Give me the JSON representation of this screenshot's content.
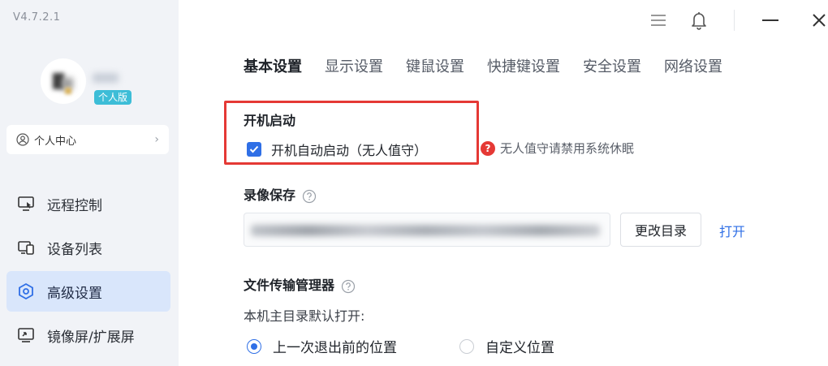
{
  "app": {
    "version": "V4.7.2.1",
    "edition_badge": "个人版"
  },
  "sidebar": {
    "profile_button": {
      "label": "个人中心",
      "icon": "user-circle-icon",
      "chevron": "›"
    },
    "items": [
      {
        "label": "远程控制",
        "icon": "remote-control-icon",
        "active": false
      },
      {
        "label": "设备列表",
        "icon": "device-list-icon",
        "active": false
      },
      {
        "label": "高级设置",
        "icon": "hexagon-settings-icon",
        "active": true
      },
      {
        "label": "镜像屏/扩展屏",
        "icon": "screen-mirror-icon",
        "active": false
      }
    ]
  },
  "titlebar": {
    "icons": [
      "menu-icon",
      "bell-icon",
      "minimize-icon",
      "close-icon"
    ]
  },
  "tabs": [
    {
      "label": "基本设置",
      "active": true
    },
    {
      "label": "显示设置",
      "active": false
    },
    {
      "label": "键鼠设置",
      "active": false
    },
    {
      "label": "快捷键设置",
      "active": false
    },
    {
      "label": "安全设置",
      "active": false
    },
    {
      "label": "网络设置",
      "active": false
    }
  ],
  "startup": {
    "title": "开机启动",
    "checkbox_label": "开机自动启动（无人值守）",
    "checked": true,
    "hint_icon": "?",
    "hint": "无人值守请禁用系统休眠"
  },
  "recording": {
    "title": "录像保存",
    "change_button": "更改目录",
    "open_link": "打开"
  },
  "file_transfer": {
    "title": "文件传输管理器",
    "default_dir_label": "本机主目录默认打开:",
    "options": [
      {
        "label": "上一次退出前的位置",
        "selected": true
      },
      {
        "label": "自定义位置",
        "selected": false
      }
    ]
  },
  "colors": {
    "accent": "#2f6fe6",
    "highlight_border": "#e53935",
    "sidebar_bg": "#f1f3f7",
    "active_nav_bg": "#d9e6fb",
    "badge_bg": "#3dbdd7"
  }
}
